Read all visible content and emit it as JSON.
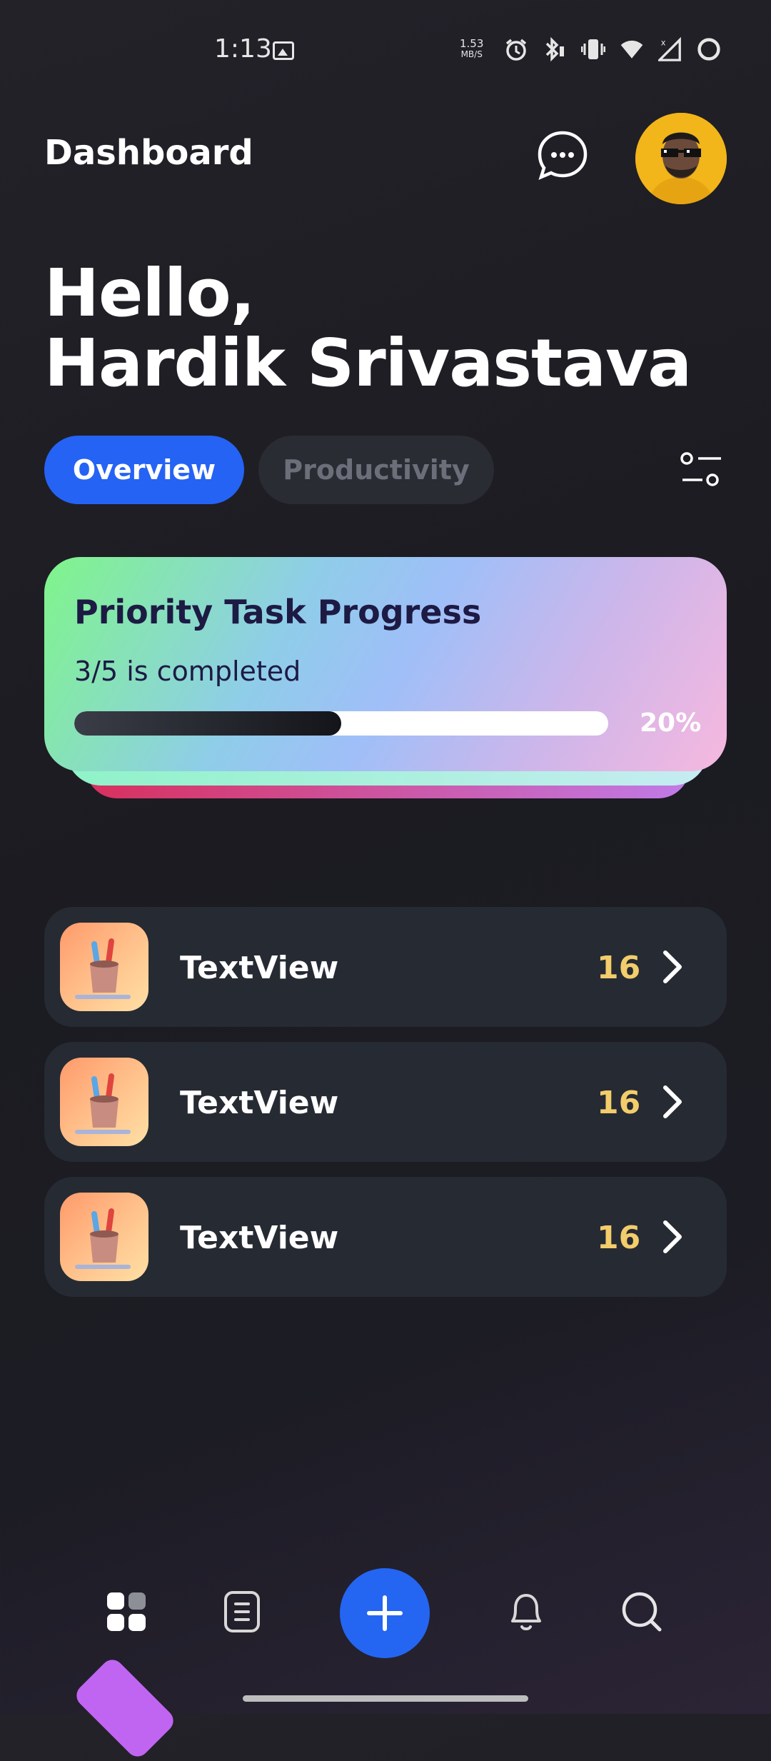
{
  "status_bar": {
    "time": "1:13",
    "net_speed_value": "1.53",
    "net_speed_unit": "MB/S",
    "icons": [
      "image-icon",
      "alarm-icon",
      "bluetooth-icon",
      "vibrate-icon",
      "wifi-icon",
      "signal-icon",
      "battery-icon"
    ]
  },
  "header": {
    "title": "Dashboard",
    "chat_icon": "chat-bubble-icon",
    "avatar_icon": "user-avatar"
  },
  "greeting": {
    "line1": "Hello,",
    "line2": "Hardik Srivastava"
  },
  "tabs": [
    {
      "label": "Overview",
      "active": true
    },
    {
      "label": "Productivity",
      "active": false
    }
  ],
  "filter_icon": "filter-toggle-icon",
  "progress_card": {
    "title": "Priority Task Progress",
    "subtitle": "3/5 is completed",
    "percent_label": "20%",
    "fill_fraction": 0.5
  },
  "list": [
    {
      "label": "TextView",
      "count": "16",
      "icon": "pencil-cup-icon"
    },
    {
      "label": "TextView",
      "count": "16",
      "icon": "pencil-cup-icon"
    },
    {
      "label": "TextView",
      "count": "16",
      "icon": "pencil-cup-icon"
    }
  ],
  "bottom_nav": {
    "items": [
      "grid-icon",
      "document-icon",
      "add-icon",
      "bell-icon",
      "search-icon"
    ]
  },
  "colors": {
    "accent": "#2563f5",
    "count_yellow": "#f3cd6b",
    "card_text": "#1d1a44",
    "list_bg": "#262a33"
  }
}
